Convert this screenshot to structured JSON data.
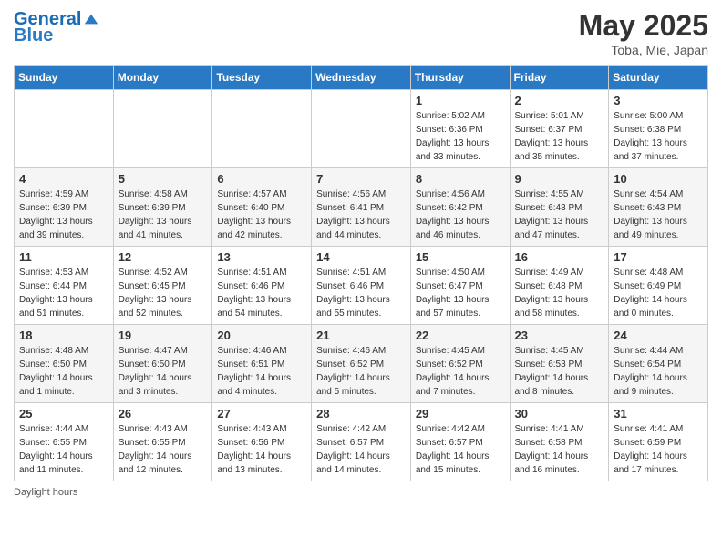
{
  "logo": {
    "line1": "General",
    "line2": "Blue"
  },
  "title": "May 2025",
  "subtitle": "Toba, Mie, Japan",
  "days_of_week": [
    "Sunday",
    "Monday",
    "Tuesday",
    "Wednesday",
    "Thursday",
    "Friday",
    "Saturday"
  ],
  "footer_label": "Daylight hours",
  "weeks": [
    [
      {
        "day": "",
        "info": ""
      },
      {
        "day": "",
        "info": ""
      },
      {
        "day": "",
        "info": ""
      },
      {
        "day": "",
        "info": ""
      },
      {
        "day": "1",
        "info": "Sunrise: 5:02 AM\nSunset: 6:36 PM\nDaylight: 13 hours\nand 33 minutes."
      },
      {
        "day": "2",
        "info": "Sunrise: 5:01 AM\nSunset: 6:37 PM\nDaylight: 13 hours\nand 35 minutes."
      },
      {
        "day": "3",
        "info": "Sunrise: 5:00 AM\nSunset: 6:38 PM\nDaylight: 13 hours\nand 37 minutes."
      }
    ],
    [
      {
        "day": "4",
        "info": "Sunrise: 4:59 AM\nSunset: 6:39 PM\nDaylight: 13 hours\nand 39 minutes."
      },
      {
        "day": "5",
        "info": "Sunrise: 4:58 AM\nSunset: 6:39 PM\nDaylight: 13 hours\nand 41 minutes."
      },
      {
        "day": "6",
        "info": "Sunrise: 4:57 AM\nSunset: 6:40 PM\nDaylight: 13 hours\nand 42 minutes."
      },
      {
        "day": "7",
        "info": "Sunrise: 4:56 AM\nSunset: 6:41 PM\nDaylight: 13 hours\nand 44 minutes."
      },
      {
        "day": "8",
        "info": "Sunrise: 4:56 AM\nSunset: 6:42 PM\nDaylight: 13 hours\nand 46 minutes."
      },
      {
        "day": "9",
        "info": "Sunrise: 4:55 AM\nSunset: 6:43 PM\nDaylight: 13 hours\nand 47 minutes."
      },
      {
        "day": "10",
        "info": "Sunrise: 4:54 AM\nSunset: 6:43 PM\nDaylight: 13 hours\nand 49 minutes."
      }
    ],
    [
      {
        "day": "11",
        "info": "Sunrise: 4:53 AM\nSunset: 6:44 PM\nDaylight: 13 hours\nand 51 minutes."
      },
      {
        "day": "12",
        "info": "Sunrise: 4:52 AM\nSunset: 6:45 PM\nDaylight: 13 hours\nand 52 minutes."
      },
      {
        "day": "13",
        "info": "Sunrise: 4:51 AM\nSunset: 6:46 PM\nDaylight: 13 hours\nand 54 minutes."
      },
      {
        "day": "14",
        "info": "Sunrise: 4:51 AM\nSunset: 6:46 PM\nDaylight: 13 hours\nand 55 minutes."
      },
      {
        "day": "15",
        "info": "Sunrise: 4:50 AM\nSunset: 6:47 PM\nDaylight: 13 hours\nand 57 minutes."
      },
      {
        "day": "16",
        "info": "Sunrise: 4:49 AM\nSunset: 6:48 PM\nDaylight: 13 hours\nand 58 minutes."
      },
      {
        "day": "17",
        "info": "Sunrise: 4:48 AM\nSunset: 6:49 PM\nDaylight: 14 hours\nand 0 minutes."
      }
    ],
    [
      {
        "day": "18",
        "info": "Sunrise: 4:48 AM\nSunset: 6:50 PM\nDaylight: 14 hours\nand 1 minute."
      },
      {
        "day": "19",
        "info": "Sunrise: 4:47 AM\nSunset: 6:50 PM\nDaylight: 14 hours\nand 3 minutes."
      },
      {
        "day": "20",
        "info": "Sunrise: 4:46 AM\nSunset: 6:51 PM\nDaylight: 14 hours\nand 4 minutes."
      },
      {
        "day": "21",
        "info": "Sunrise: 4:46 AM\nSunset: 6:52 PM\nDaylight: 14 hours\nand 5 minutes."
      },
      {
        "day": "22",
        "info": "Sunrise: 4:45 AM\nSunset: 6:52 PM\nDaylight: 14 hours\nand 7 minutes."
      },
      {
        "day": "23",
        "info": "Sunrise: 4:45 AM\nSunset: 6:53 PM\nDaylight: 14 hours\nand 8 minutes."
      },
      {
        "day": "24",
        "info": "Sunrise: 4:44 AM\nSunset: 6:54 PM\nDaylight: 14 hours\nand 9 minutes."
      }
    ],
    [
      {
        "day": "25",
        "info": "Sunrise: 4:44 AM\nSunset: 6:55 PM\nDaylight: 14 hours\nand 11 minutes."
      },
      {
        "day": "26",
        "info": "Sunrise: 4:43 AM\nSunset: 6:55 PM\nDaylight: 14 hours\nand 12 minutes."
      },
      {
        "day": "27",
        "info": "Sunrise: 4:43 AM\nSunset: 6:56 PM\nDaylight: 14 hours\nand 13 minutes."
      },
      {
        "day": "28",
        "info": "Sunrise: 4:42 AM\nSunset: 6:57 PM\nDaylight: 14 hours\nand 14 minutes."
      },
      {
        "day": "29",
        "info": "Sunrise: 4:42 AM\nSunset: 6:57 PM\nDaylight: 14 hours\nand 15 minutes."
      },
      {
        "day": "30",
        "info": "Sunrise: 4:41 AM\nSunset: 6:58 PM\nDaylight: 14 hours\nand 16 minutes."
      },
      {
        "day": "31",
        "info": "Sunrise: 4:41 AM\nSunset: 6:59 PM\nDaylight: 14 hours\nand 17 minutes."
      }
    ]
  ]
}
